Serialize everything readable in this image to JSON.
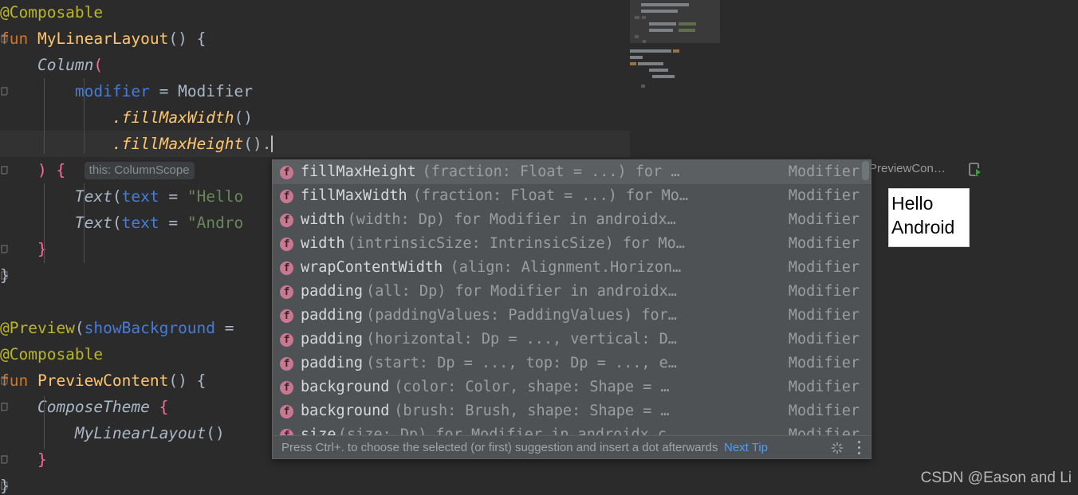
{
  "editor": {
    "lines": [
      {
        "indent": 0,
        "fold": false,
        "segments": [
          {
            "text": "@Composable",
            "cls": "t-ann"
          }
        ]
      },
      {
        "indent": 0,
        "fold": true,
        "segments": [
          {
            "text": "fun ",
            "cls": "t-kw"
          },
          {
            "text": "MyLinearLayout",
            "cls": "t-fnname"
          },
          {
            "text": "() {",
            "cls": "t-plain"
          }
        ]
      },
      {
        "indent": 0,
        "fold": false,
        "segments": [
          {
            "text": "    Column",
            "cls": "t-fncall"
          },
          {
            "text": "(",
            "cls": "t-pink"
          }
        ]
      },
      {
        "indent": 0,
        "fold": true,
        "segments": [
          {
            "text": "        modifier",
            "cls": "t-named"
          },
          {
            "text": " = ",
            "cls": "t-plain"
          },
          {
            "text": "Modifier",
            "cls": "t-plain"
          }
        ]
      },
      {
        "indent": 0,
        "fold": false,
        "segments": [
          {
            "text": "            .fillMaxWidth",
            "cls": "t-fnname t-ital"
          },
          {
            "text": "()",
            "cls": "t-plain"
          }
        ]
      },
      {
        "indent": 0,
        "fold": false,
        "segments": [
          {
            "text": "            .fillMaxHeight",
            "cls": "t-fnname t-ital"
          },
          {
            "text": "().",
            "cls": "t-plain"
          }
        ]
      },
      {
        "indent": 0,
        "fold": true,
        "segments": [
          {
            "text": "    )",
            "cls": "t-pink"
          },
          {
            "text": " {",
            "cls": "t-pink"
          },
          {
            "text": "  ",
            "cls": "t-plain"
          },
          {
            "text": "this: ColumnScope",
            "cls": "hint"
          }
        ]
      },
      {
        "indent": 0,
        "fold": false,
        "segments": [
          {
            "text": "        Text",
            "cls": "t-fncall"
          },
          {
            "text": "(",
            "cls": "t-plain"
          },
          {
            "text": "text",
            "cls": "t-named"
          },
          {
            "text": " = ",
            "cls": "t-plain"
          },
          {
            "text": "\"Hello",
            "cls": "t-str"
          }
        ]
      },
      {
        "indent": 0,
        "fold": false,
        "segments": [
          {
            "text": "        Text",
            "cls": "t-fncall"
          },
          {
            "text": "(",
            "cls": "t-plain"
          },
          {
            "text": "text",
            "cls": "t-named"
          },
          {
            "text": " = ",
            "cls": "t-plain"
          },
          {
            "text": "\"Andro",
            "cls": "t-str"
          }
        ]
      },
      {
        "indent": 0,
        "fold": true,
        "segments": [
          {
            "text": "    }",
            "cls": "t-pink"
          }
        ]
      },
      {
        "indent": 0,
        "fold": true,
        "segments": [
          {
            "text": "}",
            "cls": "t-plain"
          }
        ]
      },
      {
        "indent": 0,
        "fold": false,
        "segments": []
      },
      {
        "indent": 0,
        "fold": false,
        "segments": [
          {
            "text": "@Preview",
            "cls": "t-ann"
          },
          {
            "text": "(",
            "cls": "t-plain"
          },
          {
            "text": "showBackground",
            "cls": "t-named"
          },
          {
            "text": " = ",
            "cls": "t-plain"
          }
        ]
      },
      {
        "indent": 0,
        "fold": false,
        "segments": [
          {
            "text": "@Composable",
            "cls": "t-ann"
          }
        ]
      },
      {
        "indent": 0,
        "fold": true,
        "segments": [
          {
            "text": "fun ",
            "cls": "t-kw"
          },
          {
            "text": "PreviewContent",
            "cls": "t-fnname"
          },
          {
            "text": "() {",
            "cls": "t-plain"
          }
        ]
      },
      {
        "indent": 0,
        "fold": true,
        "segments": [
          {
            "text": "    ComposeTheme",
            "cls": "t-fncall"
          },
          {
            "text": " {",
            "cls": "t-pink"
          }
        ]
      },
      {
        "indent": 0,
        "fold": false,
        "segments": [
          {
            "text": "        MyLinearLayout",
            "cls": "t-fncall"
          },
          {
            "text": "()",
            "cls": "t-plain"
          }
        ]
      },
      {
        "indent": 0,
        "fold": true,
        "segments": [
          {
            "text": "    }",
            "cls": "t-pink"
          }
        ]
      },
      {
        "indent": 0,
        "fold": true,
        "segments": [
          {
            "text": "}",
            "cls": "t-plain"
          }
        ]
      }
    ],
    "inlay_hint": "this: ColumnScope",
    "current_line_index": 5
  },
  "autocomplete": {
    "items": [
      {
        "name": "fillMaxHeight",
        "signature": "(fraction: Float = ...) for …",
        "type": "Modifier",
        "selected": true
      },
      {
        "name": "fillMaxWidth",
        "signature": "(fraction: Float = ...) for Mo…",
        "type": "Modifier",
        "selected": false
      },
      {
        "name": "width",
        "signature": "(width: Dp) for Modifier in androidx…",
        "type": "Modifier",
        "selected": false
      },
      {
        "name": "width",
        "signature": "(intrinsicSize: IntrinsicSize) for Mo…",
        "type": "Modifier",
        "selected": false
      },
      {
        "name": "wrapContentWidth",
        "signature": "(align: Alignment.Horizon…",
        "type": "Modifier",
        "selected": false
      },
      {
        "name": "padding",
        "signature": "(all: Dp) for Modifier in androidx…",
        "type": "Modifier",
        "selected": false
      },
      {
        "name": "padding",
        "signature": "(paddingValues: PaddingValues) for…",
        "type": "Modifier",
        "selected": false
      },
      {
        "name": "padding",
        "signature": "(horizontal: Dp = ..., vertical: D…",
        "type": "Modifier",
        "selected": false
      },
      {
        "name": "padding",
        "signature": "(start: Dp = ..., top: Dp = ..., e…",
        "type": "Modifier",
        "selected": false
      },
      {
        "name": "background",
        "signature": "(color: Color, shape: Shape = …",
        "type": "Modifier",
        "selected": false
      },
      {
        "name": "background",
        "signature": "(brush: Brush, shape: Shape = …",
        "type": "Modifier",
        "selected": false
      },
      {
        "name": "size",
        "signature": "(size: Dp) for Modifier in androidx.c…",
        "type": "Modifier",
        "selected": false
      }
    ],
    "icon_letter": "f",
    "status_text": "Press Ctrl+. to choose the selected (or first) suggestion and insert a dot afterwards",
    "next_tip_label": "Next Tip"
  },
  "preview": {
    "title": "PreviewCon…",
    "device_lines": [
      "Hello",
      "Android"
    ],
    "run_icon": "run-preview-icon"
  },
  "watermark": {
    "text": "CSDN @Eason and Li"
  },
  "colors": {
    "editor_bg": "#2b2b2b",
    "popup_bg": "#4e5254",
    "popup_selected": "#5b5f61",
    "annotation": "#bbb529",
    "keyword": "#cc7832",
    "function": "#ffc66d",
    "string": "#6a8759",
    "named_arg": "#467cda",
    "brace_pink": "#ff6b9d",
    "link": "#4a9eff",
    "icon_pink": "#c87890"
  }
}
